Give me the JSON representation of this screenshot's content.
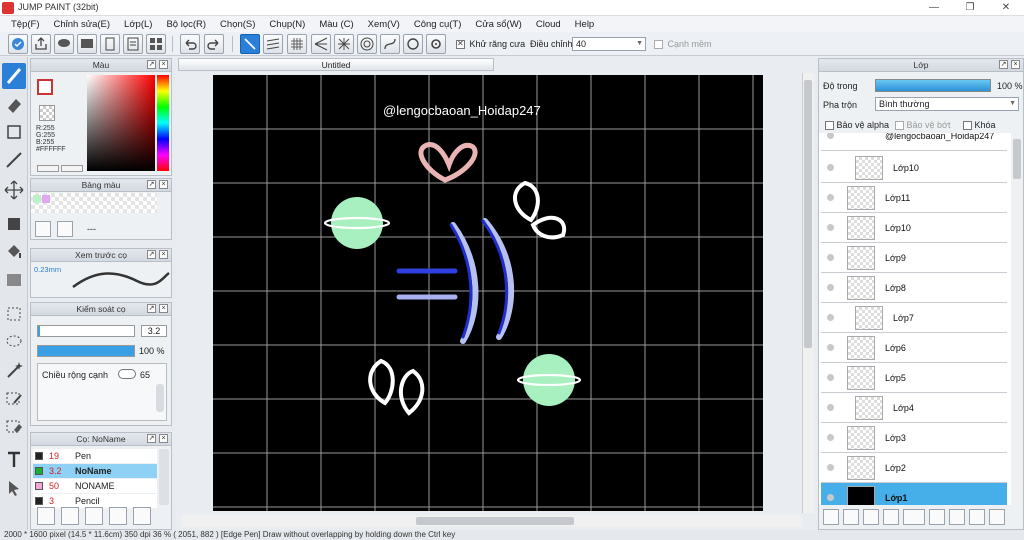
{
  "window": {
    "title": "JUMP PAINT (32bit)"
  },
  "menu": [
    "Tệp(F)",
    "Chỉnh sửa(E)",
    "Lớp(L)",
    "Bộ lọc(R)",
    "Chọn(S)",
    "Chụp(N)",
    "Màu (C)",
    "Xem(V)",
    "Công cụ(T)",
    "Cửa sổ(W)",
    "Cloud",
    "Help"
  ],
  "toolbar": {
    "antialias_label": "Khử răng cưa",
    "adjust_label": "Điều chỉnh",
    "adjust_value": "40",
    "snap_label": "Cạnh mềm"
  },
  "color_panel": {
    "title": "Màu",
    "r": "R:255",
    "g": "G:255",
    "b": "B:255",
    "hex": "#FFFFFF"
  },
  "palette_panel": {
    "title": "Bảng màu",
    "empty": "---"
  },
  "brush_preview": {
    "title": "Xem trước cọ",
    "size": "0.23mm"
  },
  "brush_control": {
    "title": "Kiểm soát cọ",
    "size": "3.2",
    "opacity": "100 %",
    "width_label": "Chiều rộng cạnh",
    "width_value": "65",
    "opacity_level": 1.0,
    "size_level": 0.02
  },
  "brush_list": {
    "title": "Cọ: NoName",
    "items": [
      {
        "size": "19",
        "name": "Pen",
        "color": "#222222"
      },
      {
        "size": "3.2",
        "name": "NoName",
        "color": "#22aa33"
      },
      {
        "size": "50",
        "name": "NONAME",
        "color": "#f3a6d8"
      },
      {
        "size": "3",
        "name": "Pencil",
        "color": "#222222"
      }
    ]
  },
  "document": {
    "tab_title": "Untitled",
    "watermark": "@lengocbaoan_Hoidap247"
  },
  "layer_panel": {
    "title": "Lớp",
    "opacity_label": "Độ trong",
    "opacity_value": "100 %",
    "blend_label": "Pha trộn",
    "blend_value": "Bình thường",
    "protect_alpha": "Bảo vệ alpha",
    "clip": "Bảo vệ bớt",
    "lock": "Khóa",
    "layers": [
      "@lengocbaoan_Hoidap247",
      "Lớp10",
      "Lớp11",
      "Lớp10",
      "Lớp9",
      "Lớp8",
      "Lớp7",
      "Lớp6",
      "Lớp5",
      "Lớp4",
      "Lớp3",
      "Lớp2",
      "Lớp1"
    ]
  },
  "status": "2000 * 1600 pixel  (14.5 * 11.6cm)  350 dpi  36 %  ( 2051, 882 )  [Edge Pen] Draw without overlapping by holding down the Ctrl key",
  "colors": {
    "accent": "#2a7fd6",
    "selected_layer": "#46aee8",
    "planet": "#a8f0c0",
    "hue_red": "#ff0000"
  }
}
